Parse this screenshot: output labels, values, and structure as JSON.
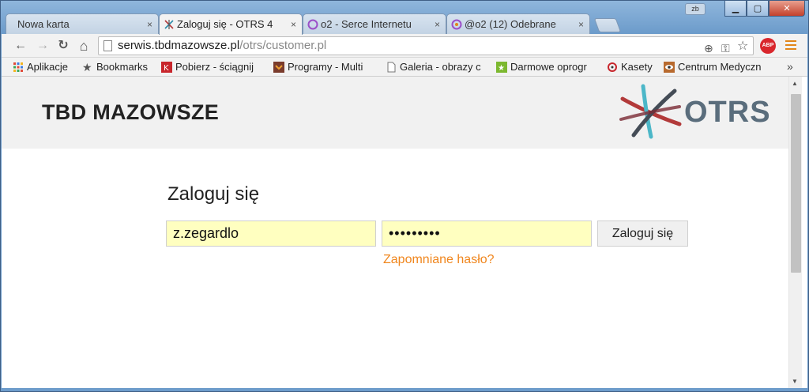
{
  "browser": {
    "profile_label": "zb",
    "tabs": [
      {
        "label": "Nowa karta",
        "active": false
      },
      {
        "label": "Zaloguj się - OTRS 4",
        "active": true
      },
      {
        "label": "o2 - Serce Internetu",
        "active": false
      },
      {
        "label": "@o2 (12) Odebrane",
        "active": false
      }
    ],
    "tab_close_glyph": "×",
    "window_buttons": {
      "minimize": "▁",
      "maximize": "▢",
      "close": "✕"
    },
    "address": {
      "domain": "serwis.tbdmazowsze.pl",
      "path": "/otrs/customer.pl"
    },
    "nav": {
      "back": "←",
      "forward": "→",
      "reload": "↻",
      "home": "⌂"
    },
    "extensions": {
      "zoom": "⊕",
      "key": "⚿",
      "star": "☆",
      "abp": "ABP"
    },
    "bookmarks": [
      {
        "label": "Aplikacje",
        "icon": "apps-grid-icon"
      },
      {
        "label": "Bookmarks",
        "icon": "star-icon"
      },
      {
        "label": "Pobierz - ściągnij",
        "icon": "pobierz-icon"
      },
      {
        "label": "Programy - Multi",
        "icon": "programy-icon"
      },
      {
        "label": "Galeria - obrazy c",
        "icon": "page-icon"
      },
      {
        "label": "Darmowe oprogr",
        "icon": "darmowe-icon"
      },
      {
        "label": "Kasety",
        "icon": "kasety-icon"
      },
      {
        "label": "Centrum Medyczn",
        "icon": "eye-icon"
      }
    ],
    "bookmarks_more": "»"
  },
  "page": {
    "company_name": "TBD MAZOWSZE",
    "logo_text": "OTRS",
    "login_title": "Zaloguj się",
    "username_value": "z.zegardlo",
    "password_value": "•••••••••",
    "login_button": "Zaloguj się",
    "forgot_password": "Zapomniane hasło?"
  },
  "colors": {
    "accent_link": "#f0861d",
    "input_bg": "#ffffc0",
    "header_bg": "#f1f1f1",
    "logo_text": "#5a6d7c"
  }
}
